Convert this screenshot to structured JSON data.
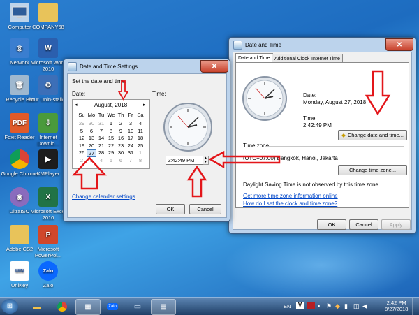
{
  "desktop": {
    "icons": [
      {
        "label": "Computer"
      },
      {
        "label": "COMPANY68"
      },
      {
        "label": "Network"
      },
      {
        "label": "Microsoft Word 2010"
      },
      {
        "label": "Recycle Bin"
      },
      {
        "label": "Your Unin-staller!"
      },
      {
        "label": "Foxit Reader"
      },
      {
        "label": "Internet Downlo..."
      },
      {
        "label": "Google Chrome"
      },
      {
        "label": "KMPlayer"
      },
      {
        "label": "UltraISO"
      },
      {
        "label": "Microsoft Excel 2010"
      },
      {
        "label": "Adobe CS2"
      },
      {
        "label": "Microsoft PowerPoi..."
      },
      {
        "label": "UniKey"
      },
      {
        "label": "Zalo"
      }
    ]
  },
  "settings_dialog": {
    "title": "Date and Time Settings",
    "instruction": "Set the date and time:",
    "date_label": "Date:",
    "time_label": "Time:",
    "calendar": {
      "month_title": "August, 2018",
      "prev": "◂",
      "next": "▸",
      "weekdays": [
        "Su",
        "Mo",
        "Tu",
        "We",
        "Th",
        "Fr",
        "Sa"
      ],
      "days": [
        "29",
        "30",
        "31",
        "1",
        "2",
        "3",
        "4",
        "5",
        "6",
        "7",
        "8",
        "9",
        "10",
        "11",
        "12",
        "13",
        "14",
        "15",
        "16",
        "17",
        "18",
        "19",
        "20",
        "21",
        "22",
        "23",
        "24",
        "25",
        "26",
        "27",
        "28",
        "29",
        "30",
        "31",
        "1",
        "2",
        "3",
        "4",
        "5",
        "6",
        "7",
        "8"
      ],
      "selected": "27"
    },
    "time_value": "2:42:49 PM",
    "change_calendar_link": "Change calendar settings",
    "ok": "OK",
    "cancel": "Cancel",
    "close": "✕"
  },
  "main_dialog": {
    "title": "Date and Time",
    "tabs": [
      "Date and Time",
      "Additional Clocks",
      "Internet Time"
    ],
    "date_label": "Date:",
    "date_value": "Monday, August 27, 2018",
    "time_label": "Time:",
    "time_value": "2:42:49 PM",
    "change_datetime_button": "Change date and time...",
    "timezone_label": "Time zone",
    "timezone_value": "(UTC+07:00) Bangkok, Hanoi, Jakarta",
    "change_timezone_button": "Change time zone...",
    "dst_note": "Daylight Saving Time is not observed by this time zone.",
    "link_more_info": "Get more time zone information online",
    "link_how_to": "How do I set the clock and time zone?",
    "ok": "OK",
    "cancel": "Cancel",
    "apply": "Apply",
    "close": "✕"
  },
  "taskbar": {
    "language": "EN",
    "clock_time": "2:42 PM",
    "clock_date": "8/27/2018",
    "zalo_badge": "Zalo"
  },
  "colors": {
    "arrow": "#e3161a",
    "accent": "#0046c8"
  }
}
